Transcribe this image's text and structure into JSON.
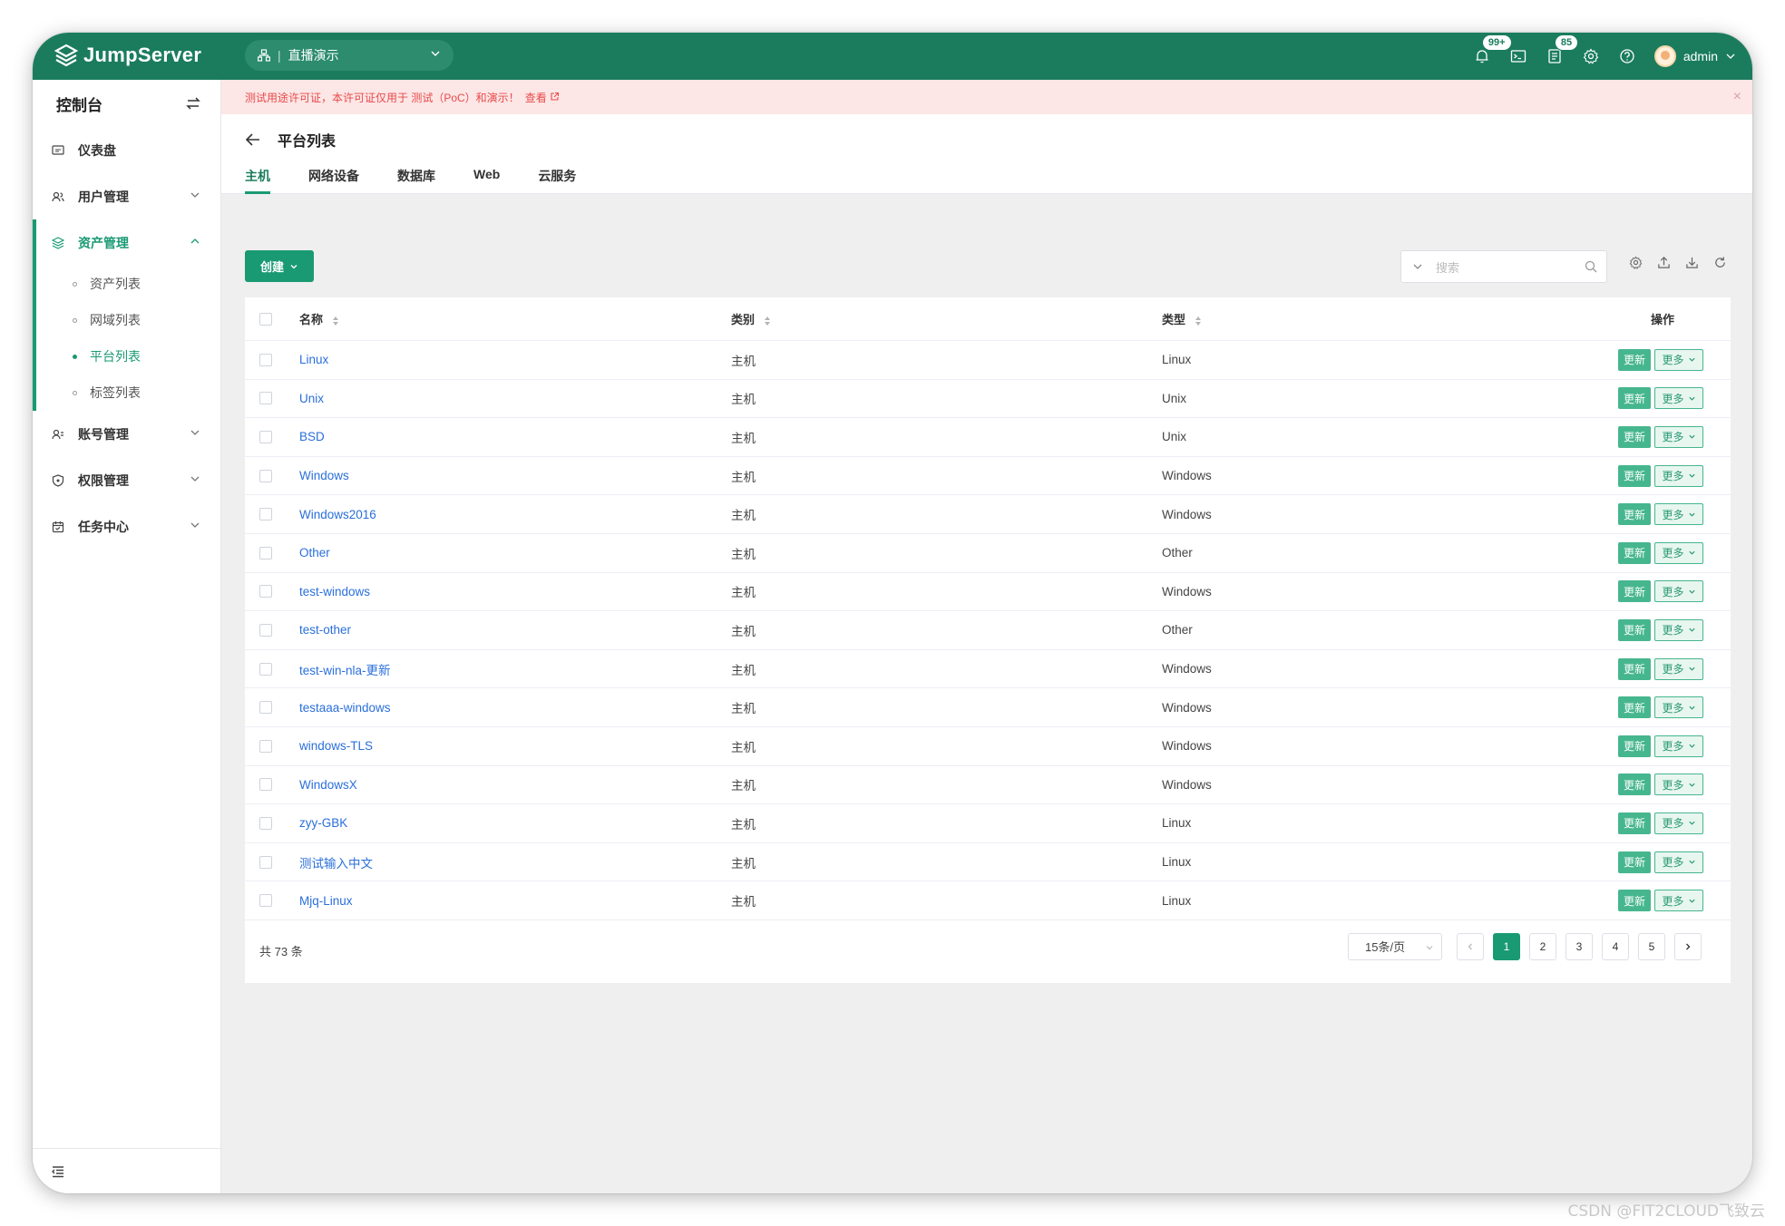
{
  "app": {
    "brand": "JumpServer",
    "org": "直播演示"
  },
  "nav": {
    "notif_badge": "99+",
    "ticket_badge": "85",
    "user": "admin"
  },
  "sidebar": {
    "title": "控制台",
    "items": [
      {
        "label": "仪表盘",
        "icon": "dashboard-icon"
      },
      {
        "label": "用户管理",
        "icon": "users-icon"
      },
      {
        "label": "资产管理",
        "icon": "assets-icon"
      },
      {
        "label": "账号管理",
        "icon": "accounts-icon"
      },
      {
        "label": "权限管理",
        "icon": "shield-icon"
      },
      {
        "label": "任务中心",
        "icon": "calendar-icon"
      }
    ],
    "subitems": [
      {
        "label": "资产列表"
      },
      {
        "label": "网域列表"
      },
      {
        "label": "平台列表"
      },
      {
        "label": "标签列表"
      }
    ]
  },
  "notice": {
    "text": "测试用途许可证，本许可证仅用于 测试（PoC）和演示！",
    "link": "查看"
  },
  "page": {
    "title": "平台列表",
    "tabs": [
      "主机",
      "网络设备",
      "数据库",
      "Web",
      "云服务"
    ]
  },
  "toolbar": {
    "create": "创建",
    "search_placeholder": "搜索"
  },
  "table": {
    "headers": {
      "name": "名称",
      "category": "类别",
      "type": "类型",
      "ops": "操作"
    },
    "rows": [
      {
        "name": "Linux",
        "category": "主机",
        "type": "Linux"
      },
      {
        "name": "Unix",
        "category": "主机",
        "type": "Unix"
      },
      {
        "name": "BSD",
        "category": "主机",
        "type": "Unix"
      },
      {
        "name": "Windows",
        "category": "主机",
        "type": "Windows"
      },
      {
        "name": "Windows2016",
        "category": "主机",
        "type": "Windows"
      },
      {
        "name": "Other",
        "category": "主机",
        "type": "Other"
      },
      {
        "name": "test-windows",
        "category": "主机",
        "type": "Windows"
      },
      {
        "name": "test-other",
        "category": "主机",
        "type": "Other"
      },
      {
        "name": "test-win-nla-更新",
        "category": "主机",
        "type": "Windows"
      },
      {
        "name": "testaaa-windows",
        "category": "主机",
        "type": "Windows"
      },
      {
        "name": "windows-TLS",
        "category": "主机",
        "type": "Windows"
      },
      {
        "name": "WindowsX",
        "category": "主机",
        "type": "Windows"
      },
      {
        "name": "zyy-GBK",
        "category": "主机",
        "type": "Linux"
      },
      {
        "name": "测试输入中文",
        "category": "主机",
        "type": "Linux"
      },
      {
        "name": "Mjq-Linux",
        "category": "主机",
        "type": "Linux"
      }
    ],
    "update_label": "更新",
    "more_label": "更多"
  },
  "pagination": {
    "total": "共 73 条",
    "page_size": "15条/页",
    "pages": [
      "1",
      "2",
      "3",
      "4",
      "5"
    ]
  },
  "watermark": "CSDN @FIT2CLOUD飞致云",
  "colors": {
    "brand": "#1a7c5d",
    "accent": "#1a9a73",
    "link": "#2a6fdb",
    "notice_bg": "#fde6e6"
  }
}
